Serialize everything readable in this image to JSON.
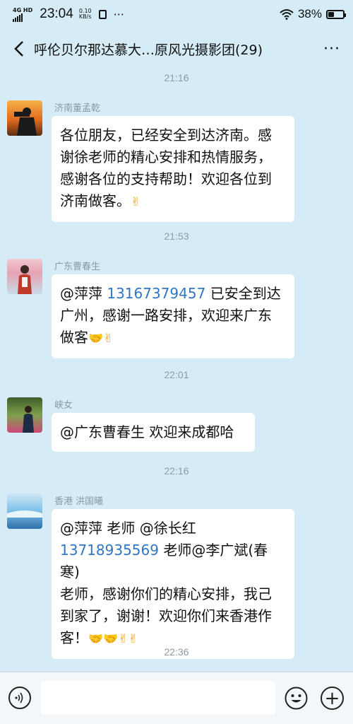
{
  "status": {
    "network": "4G HD",
    "time": "23:04",
    "speed_value": "0.10",
    "speed_unit": "KB/s",
    "more_dots": "···",
    "battery": "38%"
  },
  "header": {
    "back_icon": "chevron-left",
    "title": "呼伦贝尔那达慕大…原风光摄影团(29)",
    "more_icon": "···"
  },
  "messages": [
    {
      "timestamp": "21:16",
      "sender": "济南董孟乾",
      "lines": [
        "各位朋友，已经安全到达济南。感",
        "谢徐老师的精心安排和热情服务，",
        "感谢各位的支持帮助！欢迎各位到",
        "济南做客。"
      ],
      "emojis": [
        "clap"
      ]
    },
    {
      "timestamp": "21:53",
      "sender": "广东曹春生",
      "mention": "@萍萍 ",
      "phone": "13167379457",
      "line1_rest": " 已安全到达",
      "line2": "广州，感谢一路安排，欢迎来广东",
      "line3": "做客",
      "emojis": [
        "handshake",
        "clap"
      ]
    },
    {
      "timestamp": "22:01",
      "sender": "峡女",
      "text": "@广东曹春生  欢迎来成都哈"
    },
    {
      "timestamp": "22:16",
      "sender": "香港 洪国曦",
      "line1": "@萍萍 老师  @徐长红",
      "phone": "13718935569",
      "line2_rest": " 老师@李广斌(春寒)",
      "line3": "老师，感谢你们的精心安排，我己",
      "line4": "到家了，谢谢！欢迎你们来香港作",
      "line5": "客！",
      "emojis": [
        "handshake",
        "handshake",
        "clap",
        "clap"
      ]
    }
  ],
  "last_timestamp": "22:36",
  "input": {
    "voice_icon": "voice-icon",
    "emoji_icon": "emoji-icon",
    "plus_icon": "plus-icon"
  }
}
